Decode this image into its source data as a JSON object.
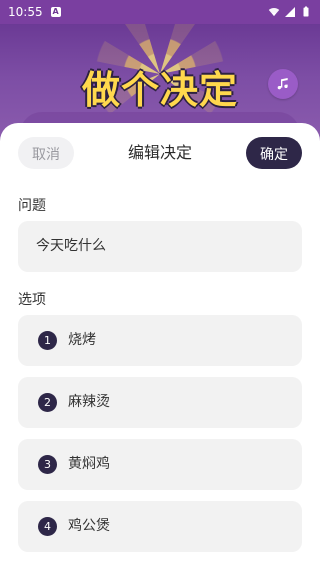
{
  "status": {
    "time": "10:55",
    "app_badge": "A"
  },
  "hero": {
    "title": "做个决定",
    "music_icon": "music-note-icon"
  },
  "sheet": {
    "cancel": "取消",
    "title": "编辑决定",
    "confirm": "确定",
    "question_label": "问题",
    "question_value": "今天吃什么",
    "options_label": "选项",
    "options": [
      {
        "num": "1",
        "text": "烧烤"
      },
      {
        "num": "2",
        "text": "麻辣烫"
      },
      {
        "num": "3",
        "text": "黄焖鸡"
      },
      {
        "num": "4",
        "text": "鸡公煲"
      }
    ]
  }
}
